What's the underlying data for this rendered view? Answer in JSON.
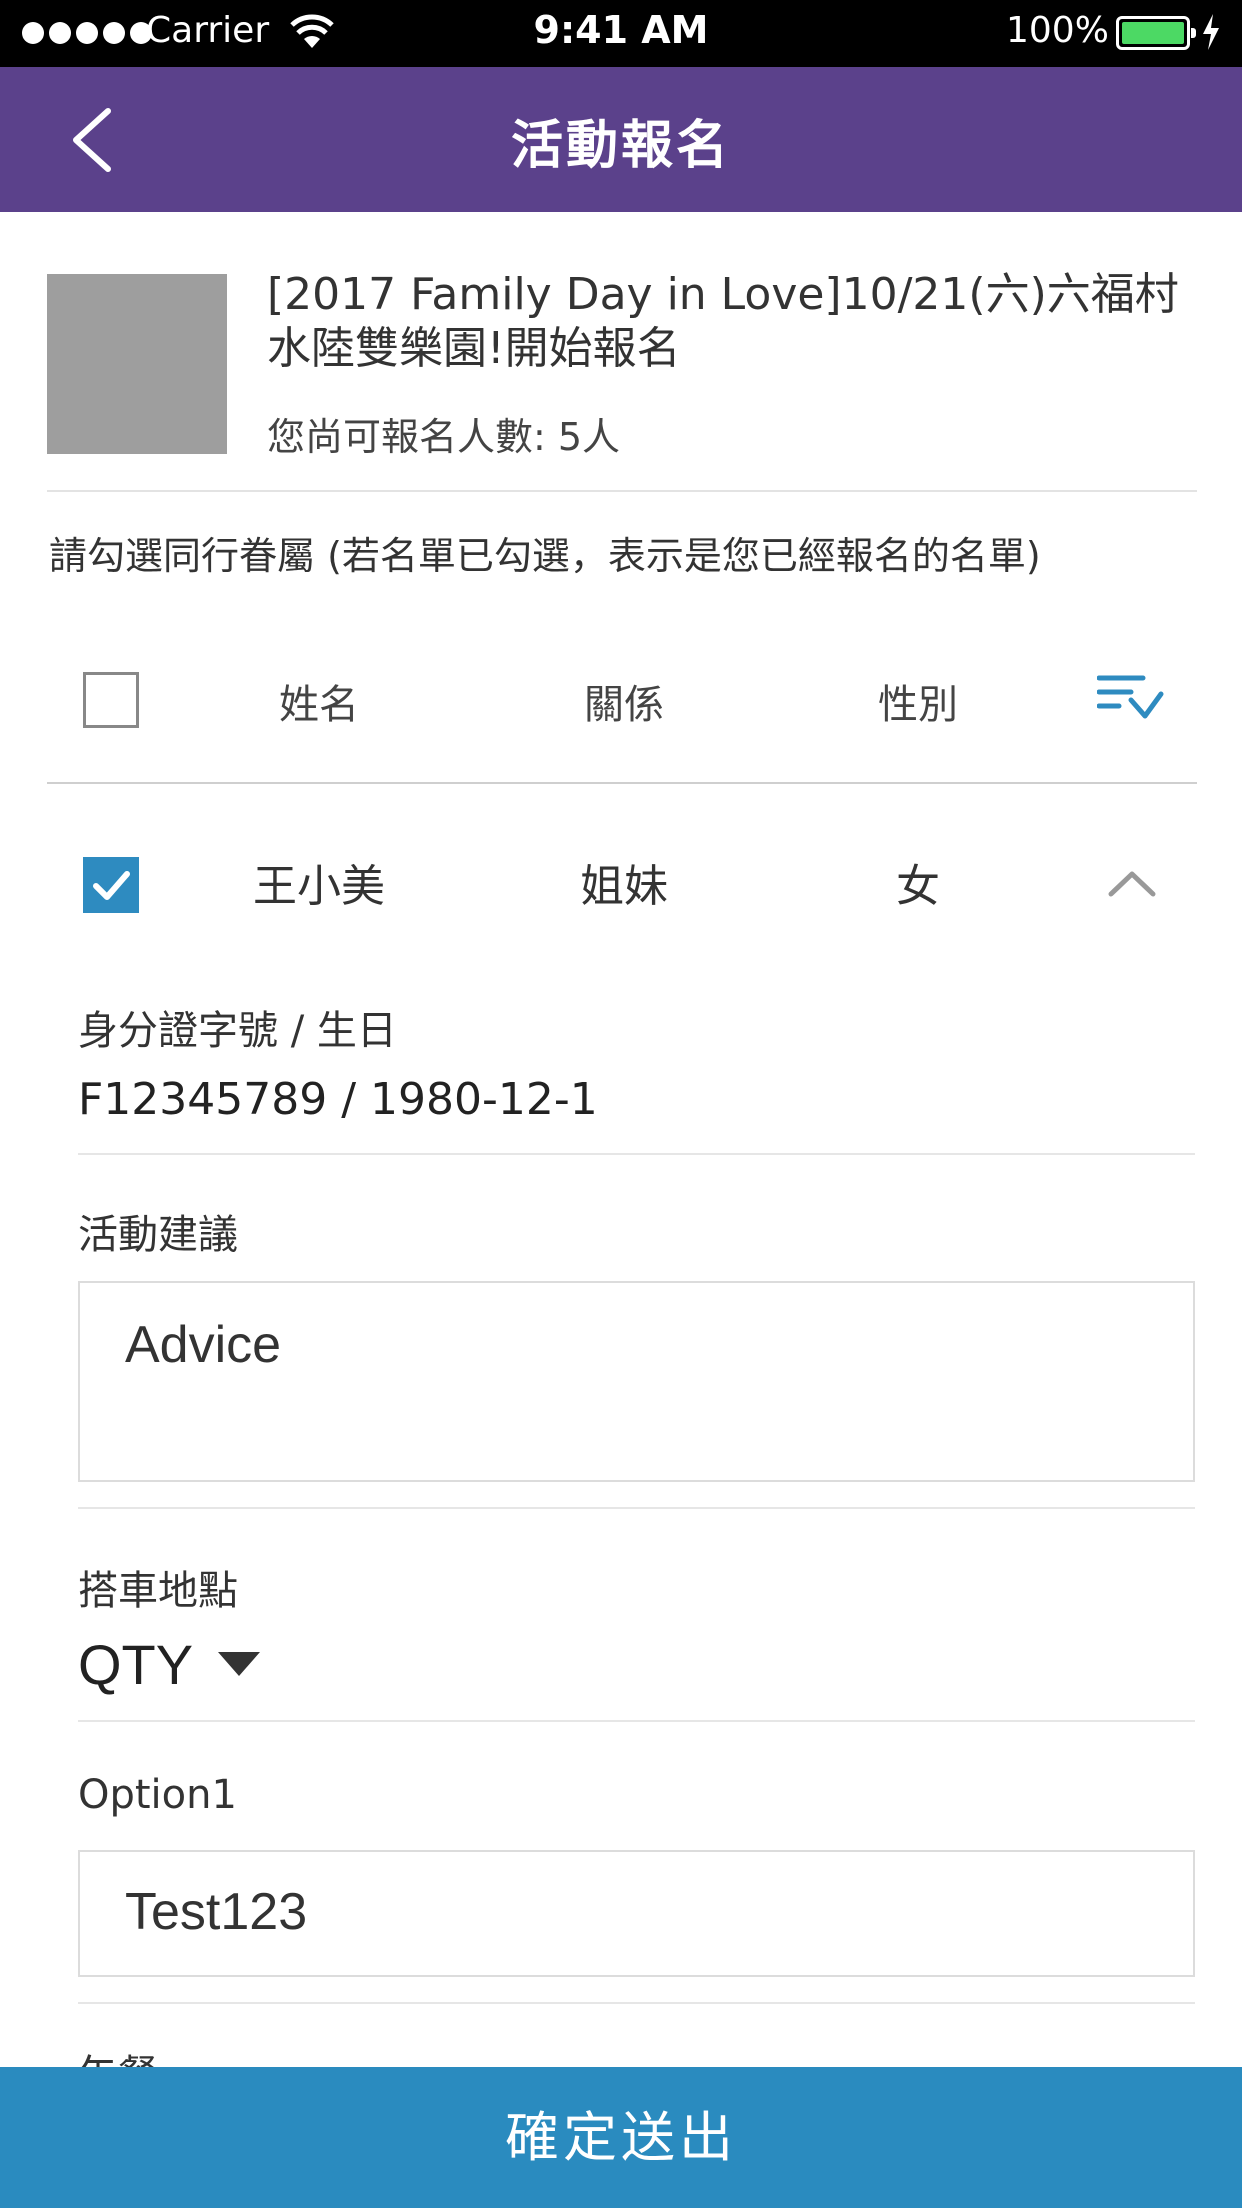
{
  "status_bar": {
    "carrier": "Carrier",
    "time": "9:41 AM",
    "battery_pct": "100%"
  },
  "navbar": {
    "title": "活動報名",
    "back_icon": "chevron-left-icon"
  },
  "event": {
    "title": "[2017 Family Day in Love]10/21(六)六福村水陸雙樂園!開始報名",
    "remaining": "您尚可報名人數: 5人"
  },
  "instruction": "請勾選同行眷屬 (若名單已勾選，表示是您已經報名的名單)",
  "table": {
    "headers": {
      "name": "姓名",
      "relation": "關係",
      "gender": "性別"
    },
    "sort_icon": "sort-down-icon",
    "rows": [
      {
        "name": "王小美",
        "relation": "姐妹",
        "gender": "女",
        "checked": true,
        "expanded": true
      }
    ]
  },
  "detail": {
    "id_label": "身分證字號 / 生日",
    "id_value": "F12345789 / 1980-12-1",
    "advice_label": "活動建議",
    "advice_value": "Advice",
    "pickup_label": "搭車地點",
    "pickup_value": "QTY",
    "option1_label": "Option1",
    "option1_value": "Test123",
    "next_label_peek": "午餐"
  },
  "submit_label": "確定送出",
  "colors": {
    "nav": "#5b418b",
    "accent": "#2a8bbf",
    "battery": "#4cd964"
  }
}
